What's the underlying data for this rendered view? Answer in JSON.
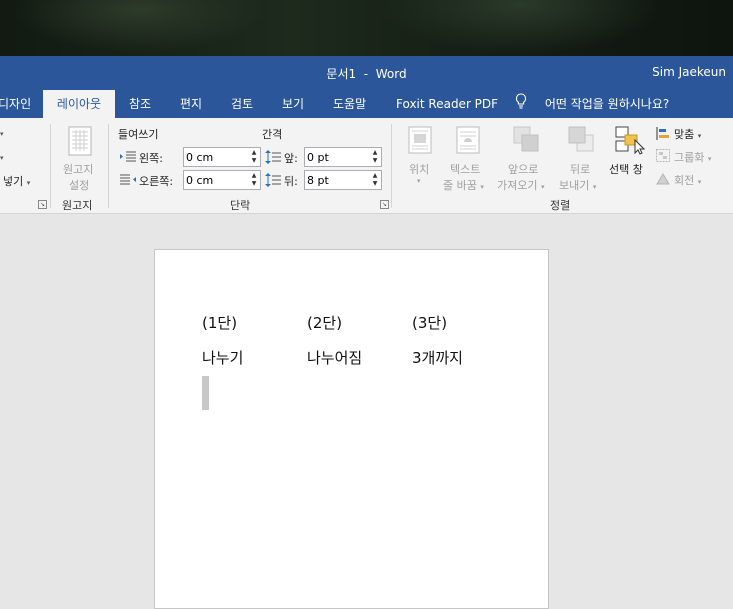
{
  "window": {
    "doc_name": "문서1",
    "separator": "-",
    "app": "Word",
    "user": "Sim Jaekeun"
  },
  "tabs": [
    {
      "label": "디자인"
    },
    {
      "label": "레이아웃"
    },
    {
      "label": "참조"
    },
    {
      "label": "편지"
    },
    {
      "label": "검토"
    },
    {
      "label": "보기"
    },
    {
      "label": "도움말"
    },
    {
      "label": "Foxit Reader PDF"
    }
  ],
  "tell_me": "어떤 작업을 원하시나요?",
  "ribbon": {
    "page_setup": {
      "item1": "",
      "item2": "",
      "item3": "넣기"
    },
    "manuscript": {
      "button_line1": "원고지",
      "button_line2": "설정",
      "group_label": "원고지"
    },
    "paragraph": {
      "indent_heading": "들여쓰기",
      "spacing_heading": "간격",
      "left_label": "왼쪽:",
      "left_value": "0 cm",
      "right_label": "오른쪽:",
      "right_value": "0 cm",
      "before_label": "앞:",
      "before_value": "0 pt",
      "after_label": "뒤:",
      "after_value": "8 pt",
      "group_label": "단락"
    },
    "arrange": {
      "position": "위치",
      "wrap_line1": "텍스트",
      "wrap_line2": "줄 바꿈",
      "forward_line1": "앞으로",
      "forward_line2": "가져오기",
      "backward_line1": "뒤로",
      "backward_line2": "보내기",
      "selection_pane": "선택 창",
      "align": "맞춤",
      "group": "그룹화",
      "rotate": "회전",
      "group_label": "정렬"
    }
  },
  "document": {
    "row1": [
      "(1단)",
      "(2단)",
      "(3단)"
    ],
    "row2": [
      "나누기",
      "나누어짐",
      "3개까지"
    ]
  },
  "colors": {
    "accent": "#2b579a",
    "ribbon_bg": "#f3f3f3",
    "canvas_bg": "#e6e6e6"
  }
}
